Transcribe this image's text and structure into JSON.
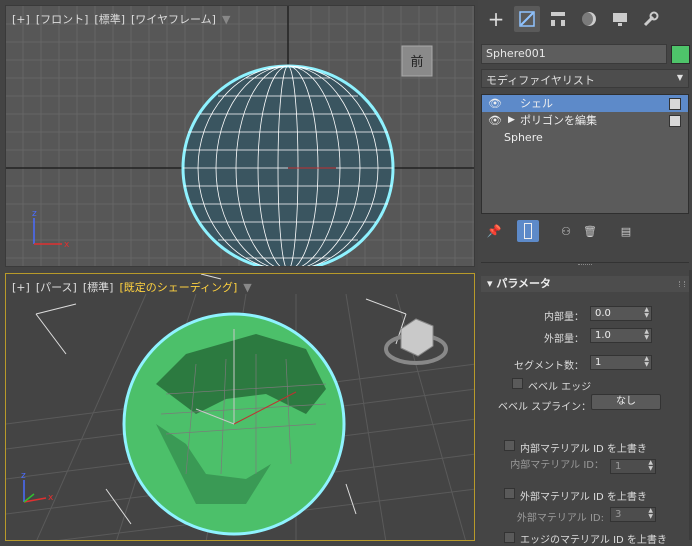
{
  "viewport_front": {
    "label_plus": "[+]",
    "label_view": "[フロント]",
    "label_mode": "[標準]",
    "label_shading": "[ワイヤフレーム]",
    "viewcube_label": "前"
  },
  "viewport_persp": {
    "label_plus": "[+]",
    "label_view": "[パース]",
    "label_mode": "[標準]",
    "label_shading": "[既定のシェーディング]"
  },
  "panel": {
    "object_name": "Sphere001",
    "object_color": "#4ec46a",
    "modifier_list": "モディファイヤリスト",
    "stack": [
      {
        "label": "シェル",
        "selected": true
      },
      {
        "label": "ポリゴンを編集",
        "selected": false
      },
      {
        "label": "Sphere",
        "selected": false
      }
    ],
    "rollout_title": "パラメータ",
    "params": {
      "inner_label": "内部量：",
      "inner_value": "0.0",
      "outer_label": "外部量：",
      "outer_value": "1.0",
      "segments_label": "セグメント数：",
      "segments_value": "1",
      "bevel_edges_label": "ベベル エッジ",
      "bevel_spline_label": "ベベル スプライン：",
      "bevel_spline_button": "なし",
      "override_inner_mat_label": "内部マテリアル ID を上書き",
      "inner_mat_id_label": "内部マテリアル ID：",
      "inner_mat_id_value": "1",
      "override_outer_mat_label": "外部マテリアル ID を上書き",
      "outer_mat_id_label": "外部マテリアル ID:",
      "outer_mat_id_value": "3",
      "override_edge_mat_label": "エッジのマテリアル ID を上書き"
    }
  },
  "colors": {
    "selection_blue": "#5d8ac9",
    "viewport_border_active": "#b89a2a",
    "wire_cyan": "#8ff2ff",
    "sphere_green": "#4cc06a"
  }
}
